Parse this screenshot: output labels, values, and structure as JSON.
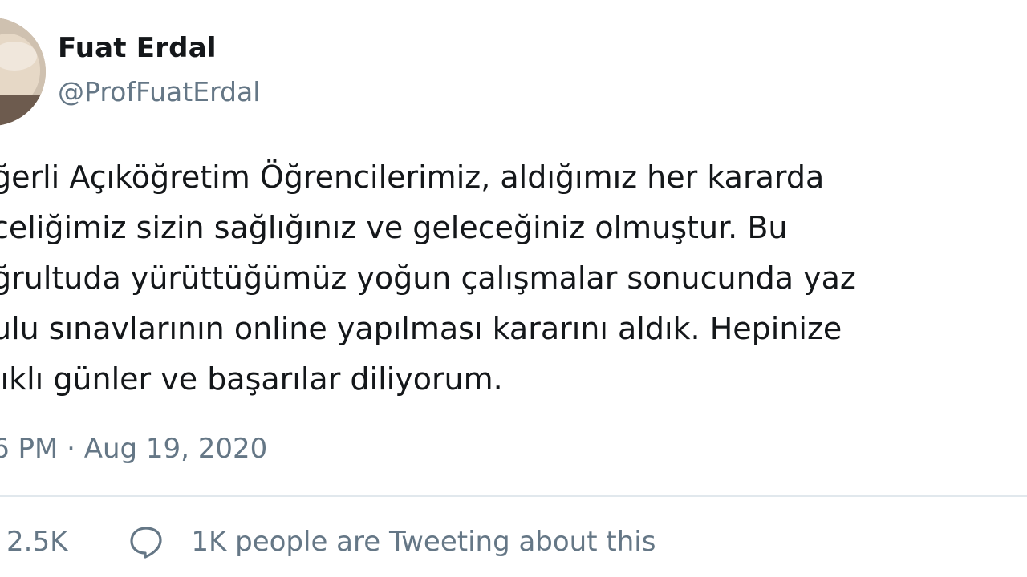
{
  "author": {
    "display_name": "Fuat Erdal",
    "handle": "@ProfFuatErdal"
  },
  "tweet": {
    "lines": [
      "ğerli Açıköğretim Öğrencilerimiz, aldığımız her kararda",
      "celiğimiz sizin sağlığınız ve geleceğiniz olmuştur. Bu",
      "ğrultuda yürüttüğümüz yoğun çalışmalar sonucunda yaz",
      "ulu sınavlarının online yapılması kararını aldık. Hepinize",
      "lıklı günler ve başarılar diliyorum."
    ],
    "timestamp": "6 PM · Aug 19, 2020"
  },
  "actions": {
    "like_count": "2.5K",
    "reply_icon": "speech-bubble-icon",
    "conversation_text": "1K people are Tweeting about this"
  },
  "colors": {
    "primary_text": "#14171a",
    "secondary_text": "#657786",
    "divider": "#e1e8ed"
  }
}
